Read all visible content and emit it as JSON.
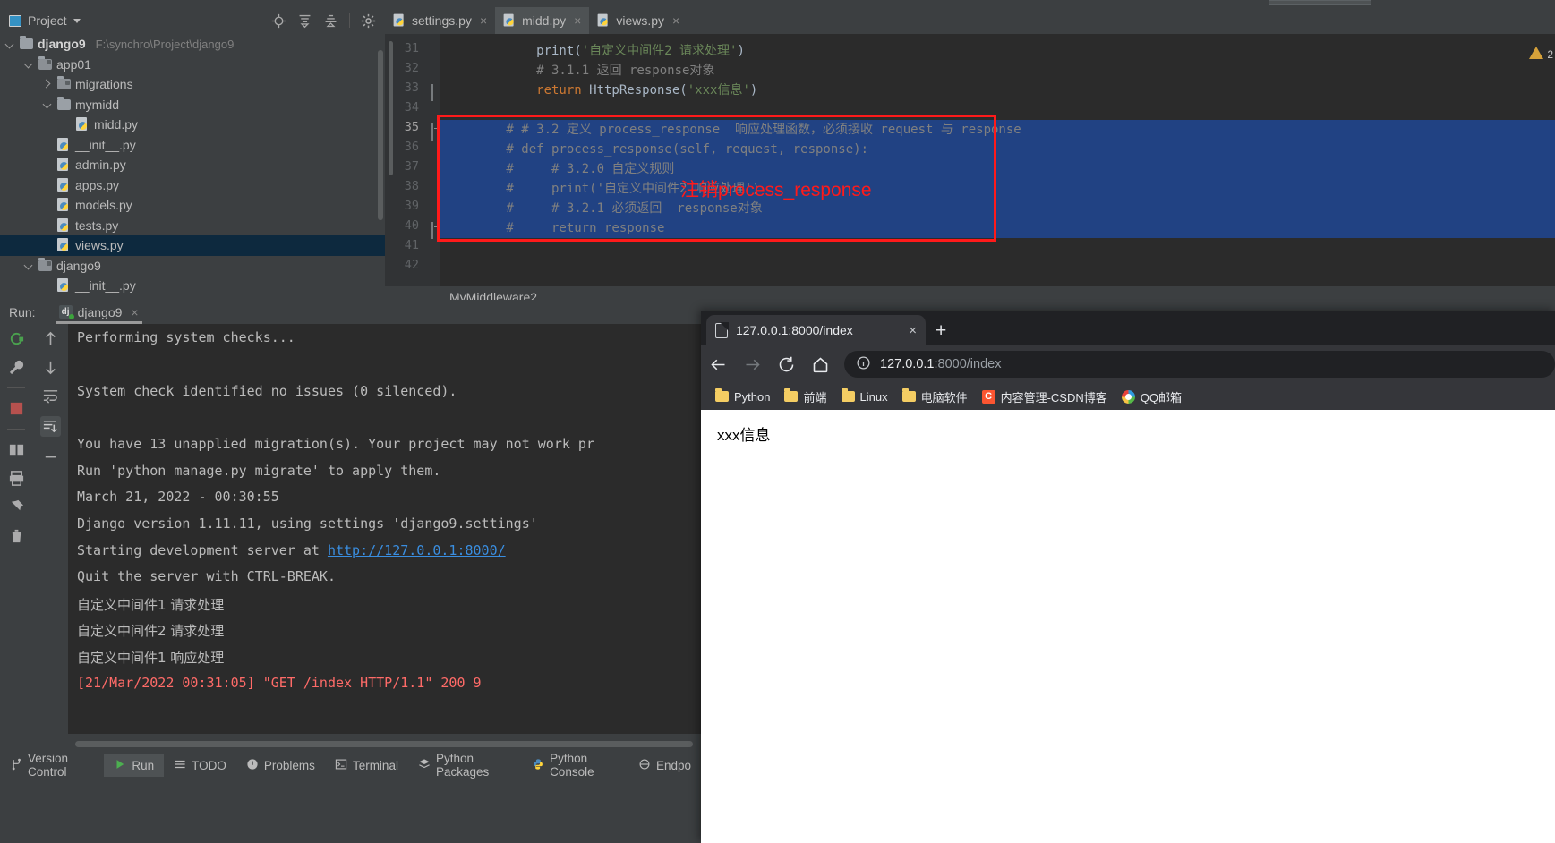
{
  "ide": {
    "project_panel": {
      "title": "Project",
      "tree": [
        {
          "label": "django9",
          "path": "F:\\synchro\\Project\\django9",
          "kind": "folder",
          "depth": 0,
          "arrow": "down",
          "bold": true,
          "selected": false
        },
        {
          "label": "app01",
          "path": "",
          "kind": "folder-dark",
          "depth": 1,
          "arrow": "down",
          "bold": false,
          "selected": false
        },
        {
          "label": "migrations",
          "path": "",
          "kind": "folder-dark",
          "depth": 2,
          "arrow": "right",
          "bold": false,
          "selected": false
        },
        {
          "label": "mymidd",
          "path": "",
          "kind": "folder",
          "depth": 2,
          "arrow": "down",
          "bold": false,
          "selected": false
        },
        {
          "label": "midd.py",
          "path": "",
          "kind": "python",
          "depth": 3,
          "arrow": "none",
          "bold": false,
          "selected": false
        },
        {
          "label": "__init__.py",
          "path": "",
          "kind": "python",
          "depth": 2,
          "arrow": "none",
          "bold": false,
          "selected": false
        },
        {
          "label": "admin.py",
          "path": "",
          "kind": "python",
          "depth": 2,
          "arrow": "none",
          "bold": false,
          "selected": false
        },
        {
          "label": "apps.py",
          "path": "",
          "kind": "python",
          "depth": 2,
          "arrow": "none",
          "bold": false,
          "selected": false
        },
        {
          "label": "models.py",
          "path": "",
          "kind": "python",
          "depth": 2,
          "arrow": "none",
          "bold": false,
          "selected": false
        },
        {
          "label": "tests.py",
          "path": "",
          "kind": "python",
          "depth": 2,
          "arrow": "none",
          "bold": false,
          "selected": false
        },
        {
          "label": "views.py",
          "path": "",
          "kind": "python",
          "depth": 2,
          "arrow": "none",
          "bold": false,
          "selected": true
        },
        {
          "label": "django9",
          "path": "",
          "kind": "folder-dark",
          "depth": 1,
          "arrow": "down",
          "bold": false,
          "selected": false
        },
        {
          "label": "__init__.py",
          "path": "",
          "kind": "python",
          "depth": 2,
          "arrow": "none",
          "bold": false,
          "selected": false
        }
      ]
    },
    "editor": {
      "tabs": [
        {
          "label": "settings.py",
          "active": false
        },
        {
          "label": "midd.py",
          "active": true
        },
        {
          "label": "views.py",
          "active": false
        }
      ],
      "first_line_number": 31,
      "lines": [
        {
          "n": 31,
          "highlight": false,
          "segments": [
            {
              "t": "            print(",
              "c": "plain"
            },
            {
              "t": "'自定义中间件2 请求处理'",
              "c": "str"
            },
            {
              "t": ")",
              "c": "plain"
            }
          ]
        },
        {
          "n": 32,
          "highlight": false,
          "segments": [
            {
              "t": "            # 3.1.1 返回 response对象",
              "c": "cmt"
            }
          ]
        },
        {
          "n": 33,
          "highlight": false,
          "segments": [
            {
              "t": "            return",
              "c": "kw"
            },
            {
              "t": " HttpResponse(",
              "c": "plain"
            },
            {
              "t": "'xxx信息'",
              "c": "str"
            },
            {
              "t": ")",
              "c": "plain"
            }
          ]
        },
        {
          "n": 34,
          "highlight": false,
          "segments": [
            {
              "t": "",
              "c": "plain"
            }
          ]
        },
        {
          "n": 35,
          "highlight": true,
          "segments": [
            {
              "t": "        # # 3.2 定义 process_response  响应处理函数，必须接收 request 与 response",
              "c": "cmt"
            }
          ]
        },
        {
          "n": 36,
          "highlight": true,
          "segments": [
            {
              "t": "        # def process_response(self, request, response):",
              "c": "cmt"
            }
          ]
        },
        {
          "n": 37,
          "highlight": true,
          "segments": [
            {
              "t": "        #     # 3.2.0 自定义规则",
              "c": "cmt"
            }
          ]
        },
        {
          "n": 38,
          "highlight": true,
          "segments": [
            {
              "t": "        #     print('自定义中间件2 响应处理')",
              "c": "cmt"
            }
          ]
        },
        {
          "n": 39,
          "highlight": true,
          "segments": [
            {
              "t": "        #     # 3.2.1 必须返回  response对象",
              "c": "cmt"
            }
          ]
        },
        {
          "n": 40,
          "highlight": true,
          "segments": [
            {
              "t": "        #     return response",
              "c": "cmt"
            }
          ]
        },
        {
          "n": 41,
          "highlight": false,
          "segments": [
            {
              "t": "",
              "c": "plain"
            }
          ]
        },
        {
          "n": 42,
          "highlight": false,
          "segments": [
            {
              "t": "",
              "c": "plain"
            }
          ]
        }
      ],
      "annotation": "注销process_response",
      "annotation_color": "#ff1a1a",
      "breadcrumb": "MyMiddleware2",
      "warning_count": "2"
    },
    "run_panel": {
      "label": "Run:",
      "tab_label": "django9",
      "console_lines": [
        {
          "text": "Performing system checks...",
          "style": "normal"
        },
        {
          "text": "",
          "style": "normal"
        },
        {
          "text": "System check identified no issues (0 silenced).",
          "style": "normal"
        },
        {
          "text": "",
          "style": "normal"
        },
        {
          "text": "You have 13 unapplied migration(s). Your project may not work pr",
          "style": "normal"
        },
        {
          "text": "Run 'python manage.py migrate' to apply them.",
          "style": "normal"
        },
        {
          "text": "March 21, 2022 - 00:30:55",
          "style": "normal"
        },
        {
          "text": "Django version 1.11.11, using settings 'django9.settings'",
          "style": "normal"
        },
        {
          "text": "Starting development server at ",
          "link": "http://127.0.0.1:8000/",
          "style": "link"
        },
        {
          "text": "Quit the server with CTRL-BREAK.",
          "style": "normal"
        },
        {
          "text": "自定义中间件1 请求处理",
          "style": "cn"
        },
        {
          "text": "自定义中间件2 请求处理",
          "style": "cn"
        },
        {
          "text": "自定义中间件1 响应处理",
          "style": "cn"
        },
        {
          "text": "[21/Mar/2022 00:31:05] \"GET /index HTTP/1.1\" 200 9",
          "style": "red"
        }
      ]
    },
    "tool_windows": [
      {
        "label": "Version Control",
        "icon": "branch-icon",
        "active": false
      },
      {
        "label": "Run",
        "icon": "play-icon",
        "active": true
      },
      {
        "label": "TODO",
        "icon": "list-icon",
        "active": false
      },
      {
        "label": "Problems",
        "icon": "exclaim-icon",
        "active": false
      },
      {
        "label": "Terminal",
        "icon": "terminal-icon",
        "active": false
      },
      {
        "label": "Python Packages",
        "icon": "layers-icon",
        "active": false
      },
      {
        "label": "Python Console",
        "icon": "python-icon",
        "active": false
      },
      {
        "label": "Endpo",
        "icon": "endpoint-icon",
        "active": false
      }
    ],
    "status_text": ""
  },
  "browser": {
    "tab": {
      "title": "127.0.0.1:8000/index",
      "close": "×"
    },
    "new_tab": "+",
    "address": {
      "host": "127.0.0.1",
      "rest": ":8000/index"
    },
    "bookmarks": [
      {
        "label": "Python",
        "icon": "folder-icon"
      },
      {
        "label": "前端",
        "icon": "folder-icon"
      },
      {
        "label": "Linux",
        "icon": "folder-icon"
      },
      {
        "label": "电脑软件",
        "icon": "folder-icon"
      },
      {
        "label": "内容管理-CSDN博客",
        "icon": "csdn-icon"
      },
      {
        "label": "QQ邮箱",
        "icon": "qq-icon"
      }
    ],
    "page_text": "xxx信息"
  }
}
